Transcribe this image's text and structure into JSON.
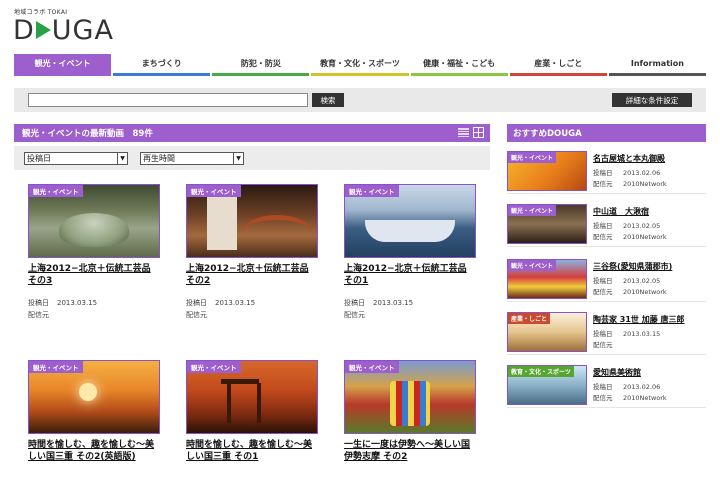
{
  "header": {
    "sub_logo": "地域コラボ TOKAI",
    "logo_left": "D",
    "logo_right": "UGA"
  },
  "nav": [
    {
      "label": "観光・イベント",
      "color": "#9d5fce"
    },
    {
      "label": "まちづくり",
      "color": "#3a7bd5"
    },
    {
      "label": "防犯・防災",
      "color": "#48a84a"
    },
    {
      "label": "教育・文化・スポーツ",
      "color": "#d0c42a"
    },
    {
      "label": "健康・福祉・こども",
      "color": "#8cc63e"
    },
    {
      "label": "産業・しごと",
      "color": "#d0463a"
    },
    {
      "label": "Information",
      "color": "#555555"
    }
  ],
  "search": {
    "value": "",
    "button_label": "検索",
    "advanced_label": "詳細な条件設定"
  },
  "main": {
    "heading": "観光・イベントの最新動画　89件",
    "sort_select": "投稿日",
    "time_select": "再生時間"
  },
  "videos": [
    {
      "tag": "観光・イベント",
      "title": "上海2012−北京＋伝統工芸品 その3",
      "date_label": "投稿日",
      "date": "2013.03.15",
      "source_label": "配信元",
      "source": ""
    },
    {
      "tag": "観光・イベント",
      "title": "上海2012−北京＋伝統工芸品 その2",
      "date_label": "投稿日",
      "date": "2013.03.15",
      "source_label": "配信元",
      "source": ""
    },
    {
      "tag": "観光・イベント",
      "title": "上海2012−北京＋伝統工芸品 その1",
      "date_label": "投稿日",
      "date": "2013.03.15",
      "source_label": "配信元",
      "source": ""
    },
    {
      "tag": "観光・イベント",
      "title": "時間を愉しむ、趣を愉しむ〜美しい国三重 その2(英語版)",
      "date_label": "",
      "date": "",
      "source_label": "",
      "source": ""
    },
    {
      "tag": "観光・イベント",
      "title": "時間を愉しむ、趣を愉しむ〜美しい国三重 その1",
      "date_label": "",
      "date": "",
      "source_label": "",
      "source": ""
    },
    {
      "tag": "観光・イベント",
      "title": "一生に一度は伊勢へ〜美しい国伊勢志摩 その2",
      "date_label": "",
      "date": "",
      "source_label": "",
      "source": ""
    }
  ],
  "sidebar": {
    "heading": "おすすめDOUGA",
    "items": [
      {
        "tag": "観光・イベント",
        "title": "名古屋城と本丸御殿",
        "date_label": "投稿日",
        "date": "2013.02.06",
        "source_label": "配信元",
        "source": "2010Network"
      },
      {
        "tag": "観光・イベント",
        "title": "中山道　大湫宿",
        "date_label": "投稿日",
        "date": "2013.02.05",
        "source_label": "配信元",
        "source": "2010Network"
      },
      {
        "tag": "観光・イベント",
        "title": "三谷祭(愛知県蒲郡市)",
        "date_label": "投稿日",
        "date": "2013.02.05",
        "source_label": "配信元",
        "source": "2010Network"
      },
      {
        "tag": "産業・しごと",
        "title": "陶芸家 31世 加藤 唐三郎",
        "date_label": "投稿日",
        "date": "2013.03.15",
        "source_label": "配信元",
        "source": ""
      },
      {
        "tag": "教育・文化・スポーツ",
        "title": "愛知県美術館",
        "date_label": "投稿日",
        "date": "2013.02.06",
        "source_label": "配信元",
        "source": "2010Network"
      }
    ]
  }
}
